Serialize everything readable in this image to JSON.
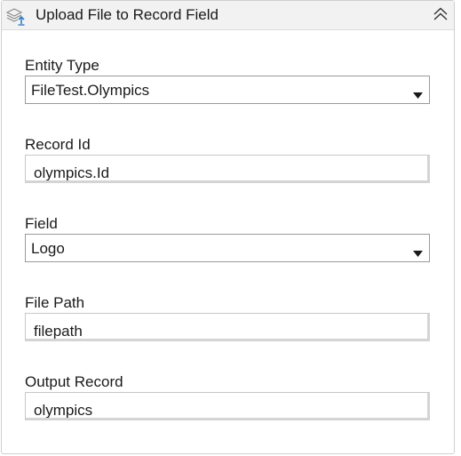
{
  "activity": {
    "title": "Upload File to Record Field",
    "icon": "upload-record-icon",
    "collapse_icon": "double-chevron-up-icon"
  },
  "fields": {
    "entity_type": {
      "label": "Entity Type",
      "value": "FileTest.Olympics"
    },
    "record_id": {
      "label": "Record Id",
      "value": "olympics.Id"
    },
    "field": {
      "label": "Field",
      "value": "Logo"
    },
    "file_path": {
      "label": "File Path",
      "value": "filepath"
    },
    "output_record": {
      "label": "Output Record",
      "value": "olympics"
    }
  }
}
